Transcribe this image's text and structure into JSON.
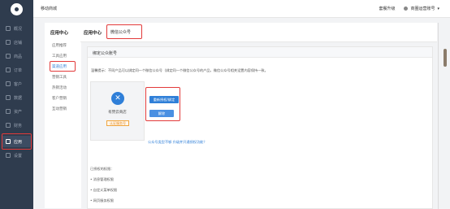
{
  "app": {
    "title": "移动商城"
  },
  "topbar": {
    "upgrade_label": "套餐升级",
    "user_label": "商圈运营账号"
  },
  "sidebar": {
    "items": [
      {
        "label": "概况",
        "icon": "dashboard-icon"
      },
      {
        "label": "店铺",
        "icon": "shop-icon"
      },
      {
        "label": "商品",
        "icon": "goods-icon"
      },
      {
        "label": "订单",
        "icon": "order-icon"
      },
      {
        "label": "客户",
        "icon": "customer-icon"
      },
      {
        "label": "数据",
        "icon": "data-icon"
      },
      {
        "label": "资产",
        "icon": "asset-icon"
      },
      {
        "label": "财务",
        "icon": "finance-icon"
      },
      {
        "label": "应用",
        "icon": "app-icon",
        "active": true
      },
      {
        "label": "设置",
        "icon": "settings-icon"
      }
    ]
  },
  "subnav": {
    "title": "应用中心",
    "items": [
      {
        "label": "应用推荐"
      },
      {
        "label": "工具应用"
      },
      {
        "label": "渠道应用",
        "active": true
      },
      {
        "label": "营销工具"
      },
      {
        "label": "热销活动"
      },
      {
        "label": "客户营销"
      },
      {
        "label": "互动营销"
      }
    ]
  },
  "tabs": {
    "center": "应用中心",
    "current": "微信公众号"
  },
  "panel": {
    "title": "绑定公众账号",
    "tip": "温馨提示：不同产品可以绑定同一个微信公众号（绑定同一个微信公众号的产品，微信公众号相关设置内容保持一致。",
    "card": {
      "name": "有赞云商店",
      "badge": "认证服务号"
    },
    "rebind_label": "重新授权/绑定",
    "unbind_label": "解除",
    "link_text": "公众号类型不够 升级并开通授权功能？",
    "perm_title": "已授权的权限：",
    "perm_items": [
      "• 消息管理权限",
      "• 自定义菜单权限",
      "• 网页服务权限"
    ]
  },
  "colors": {
    "accent": "#2f7fd8",
    "highlight": "#e23a3a",
    "sidebar_bg": "#2f3c4e"
  }
}
